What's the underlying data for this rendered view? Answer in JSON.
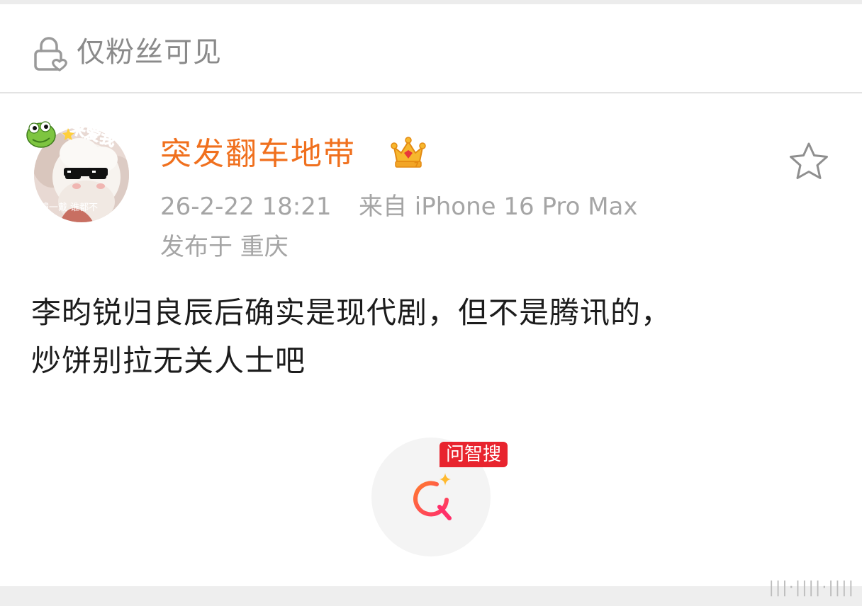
{
  "visibility": {
    "label": "仅粉丝可见",
    "icon": "lock-heart-icon"
  },
  "post": {
    "author": {
      "name": "突发翻车地带",
      "name_color": "#f0701e",
      "badge_icon": "vip-crown-icon",
      "avatar": {
        "sticker_text": "来爱我",
        "caption_text": "镜一戴 谁都不"
      }
    },
    "time": "26-2-22 18:21",
    "source": "来自 iPhone 16 Pro Max",
    "location": "发布于 重庆",
    "content_line1": "李昀锐归良辰后确实是现代剧，但不是腾讯的，",
    "content_line2": "炒饼别拉无关人士吧",
    "favorite_icon": "star-outline-icon"
  },
  "wenzhisou": {
    "badge": "问智搜",
    "icon": "ai-search-icon",
    "badge_color": "#e8242e"
  },
  "watermark": "|||·||||·||||"
}
